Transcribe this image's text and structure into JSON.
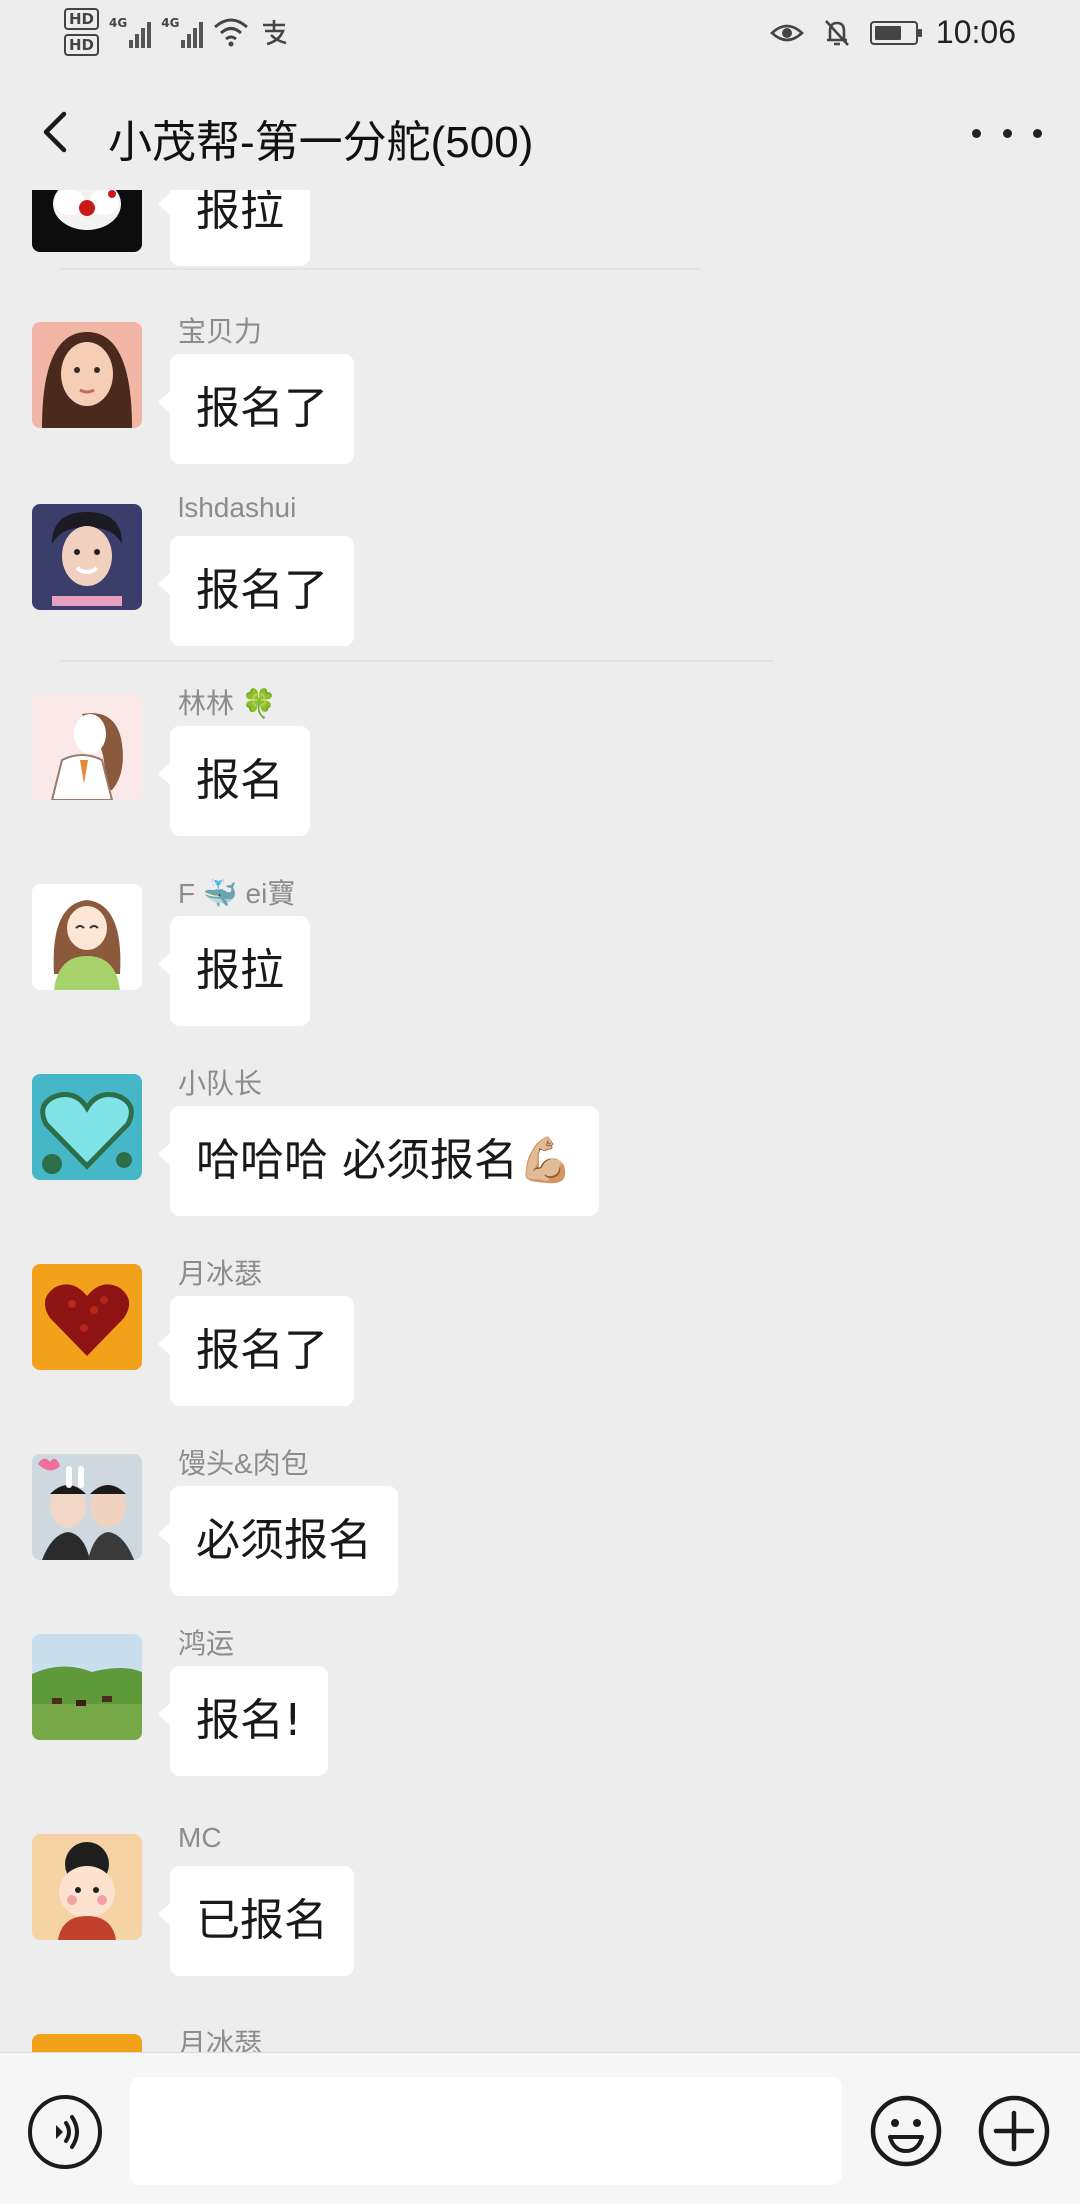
{
  "status_bar": {
    "sim1": "HD",
    "sim2": "HD",
    "network": "4G",
    "time": "10:06",
    "icons": [
      "eye-icon",
      "mute-bell-icon",
      "battery-icon",
      "wifi-icon",
      "alipay-icon"
    ]
  },
  "header": {
    "title": "小茂帮-第一分舵(500)"
  },
  "messages": [
    {
      "sender": "",
      "text": "报拉",
      "avatar": "avatar-ladybug-flower"
    },
    {
      "sender": "宝贝力",
      "text": "报名了",
      "avatar": "avatar-girl-portrait"
    },
    {
      "sender": "lshdashui",
      "text": "报名了",
      "avatar": "avatar-young-man"
    },
    {
      "sender": "林林 🍀",
      "text": "报名",
      "avatar": "avatar-cartoon-girl"
    },
    {
      "sender": "F 🐳 ei寶",
      "text": "报拉",
      "avatar": "avatar-cartoon-girl-green"
    },
    {
      "sender": "小队长",
      "text": "哈哈哈 必须报名💪🏼",
      "avatar": "avatar-heart-island"
    },
    {
      "sender": "月冰瑟",
      "text": "报名了",
      "avatar": "avatar-red-heart"
    },
    {
      "sender": "馒头&肉包",
      "text": "必须报名",
      "avatar": "avatar-couple-photo"
    },
    {
      "sender": "鸿运",
      "text": "报名!",
      "avatar": "avatar-grassland-horses"
    },
    {
      "sender": "MC",
      "text": "已报名",
      "avatar": "avatar-cartoon-kid"
    },
    {
      "sender": "月冰瑟",
      "text": "",
      "avatar": "avatar-red-heart"
    }
  ],
  "input_bar": {
    "placeholder": "",
    "voice_icon": "voice-icon",
    "emoji_icon": "emoji-icon",
    "plus_icon": "plus-icon"
  },
  "colors": {
    "background": "#ededed",
    "bubble": "#ffffff",
    "sender_text": "#8c8c8c"
  }
}
